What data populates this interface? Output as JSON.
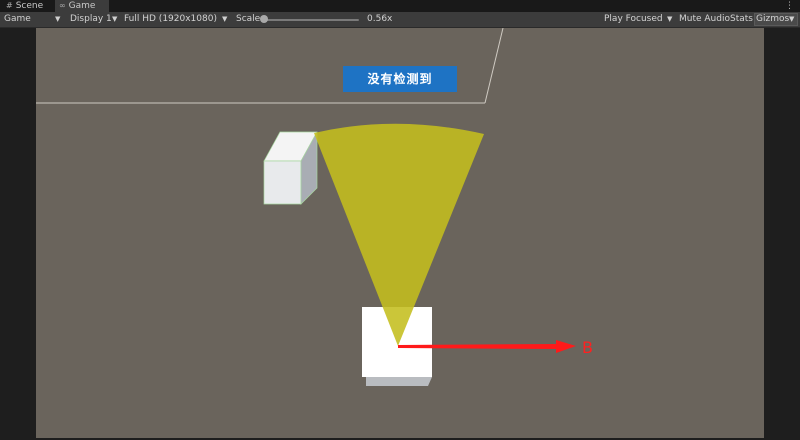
{
  "tabs": [
    {
      "icon": "grid-icon",
      "label": "Scene"
    },
    {
      "icon": "gamepad-icon",
      "label": "Game"
    }
  ],
  "toolbar": {
    "view_mode": "Game",
    "display": "Display 1",
    "resolution": "Full HD (1920x1080)",
    "scale_label": "Scale",
    "scale_value": "0.56x",
    "play_focused": "Play Focused",
    "mute_audio": "Mute Audio",
    "stats": "Stats",
    "gizmos": "Gizmos"
  },
  "game": {
    "status_label": "没有检测到",
    "target_label": "B",
    "colors": {
      "background": "#6a645c",
      "status_button": "#1e73c4",
      "vision_cone": "#c4be1e",
      "arrow": "#ff1a1a"
    }
  }
}
